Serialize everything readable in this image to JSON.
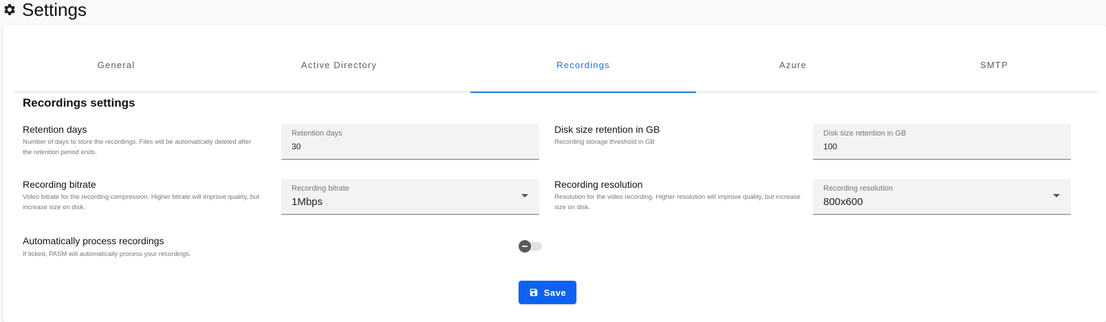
{
  "header": {
    "title": "Settings",
    "icon": "gear-icon"
  },
  "tabs": [
    {
      "label": "General"
    },
    {
      "label": "Active Directory"
    },
    {
      "label": "Recordings",
      "active": true
    },
    {
      "label": "Azure"
    },
    {
      "label": "SMTP"
    }
  ],
  "section": {
    "title": "Recordings settings"
  },
  "settings": {
    "retention_days": {
      "title": "Retention days",
      "description": "Number of days to store the recordings. Files will be automatically deleted after the retention period ends.",
      "field_label": "Retention days",
      "value": "30"
    },
    "disk_size": {
      "title": "Disk size retention in GB",
      "description": "Recording storage threshold in GB",
      "field_label": "Disk size retention in GB",
      "value": "100"
    },
    "bitrate": {
      "title": "Recording bitrate",
      "description": "Video bitrate for the recording compression. Higher bitrate will improve quality, but increase size on disk.",
      "field_label": "Recording bitrate",
      "value": "1Mbps"
    },
    "resolution": {
      "title": "Recording resolution",
      "description": "Resolution for the video recording. Higher resolution will improve quality, but increase size on disk.",
      "field_label": "Recording resolution",
      "value": "800x600"
    },
    "auto_process": {
      "title": "Automatically process recordings",
      "description": "If ticked, PASM will automatically process your recordings.",
      "enabled": false
    }
  },
  "actions": {
    "save_label": "Save"
  },
  "colors": {
    "accent": "#1f6fe0",
    "button": "#0d63ef"
  }
}
